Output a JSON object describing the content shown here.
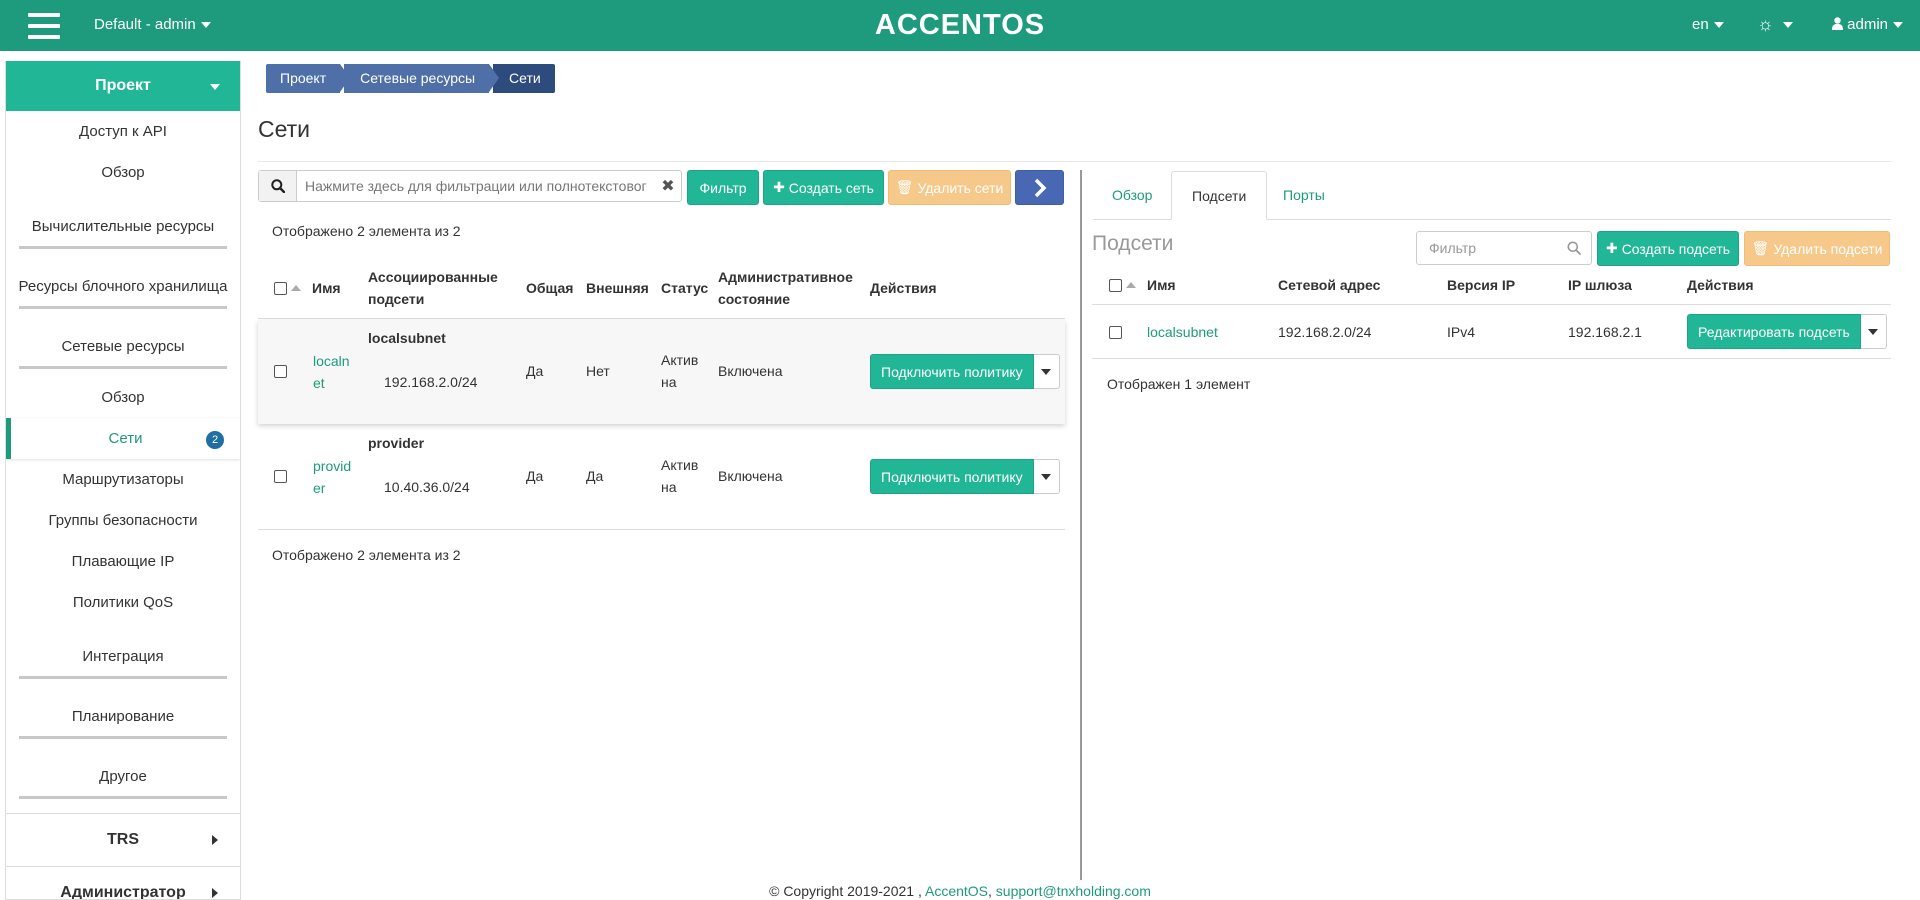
{
  "header": {
    "project_selector": "Default - admin",
    "logo": "ACCENTOS",
    "language": "en",
    "user": "admin"
  },
  "sidebar": {
    "project_label": "Проект",
    "items": [
      {
        "label": "Доступ к API",
        "type": "item"
      },
      {
        "label": "Обзор",
        "type": "item"
      },
      {
        "label": "Вычислительные ресурсы",
        "type": "section"
      },
      {
        "label": "Ресурсы блочного хранилища",
        "type": "section"
      },
      {
        "label": "Сетевые ресурсы",
        "type": "section"
      },
      {
        "label": "Обзор",
        "type": "item"
      },
      {
        "label": "Сети",
        "type": "active",
        "badge": "2"
      },
      {
        "label": "Маршрутизаторы",
        "type": "item"
      },
      {
        "label": "Группы безопасности",
        "type": "item"
      },
      {
        "label": "Плавающие IP",
        "type": "item"
      },
      {
        "label": "Политики QoS",
        "type": "item"
      },
      {
        "label": "Интеграция",
        "type": "section"
      },
      {
        "label": "Планирование",
        "type": "section"
      },
      {
        "label": "Другое",
        "type": "section"
      }
    ],
    "trs_label": "TRS",
    "admin_label": "Администратор"
  },
  "breadcrumb": [
    "Проект",
    "Сетевые ресурсы",
    "Сети"
  ],
  "page_title": "Сети",
  "networks": {
    "search_placeholder": "Нажмите здесь для фильтрации или полнотекстового ...",
    "filter_label": "Фильтр",
    "create_label": "Создать сеть",
    "delete_label": "Удалить сети",
    "count_top": "Отображено 2 элемента из 2",
    "count_bottom": "Отображено 2 элемента из 2",
    "columns": {
      "name": "Имя",
      "subnets_1": "Ассоциированные",
      "subnets_2": "подсети",
      "shared": "Общая",
      "external": "Внешняя",
      "status": "Статус",
      "admin_1": "Административное",
      "admin_2": "состояние",
      "actions": "Действия"
    },
    "rows": [
      {
        "name_1": "localn",
        "name_2": "et",
        "subnet_name": "localsubnet",
        "subnet_cidr": "192.168.2.0/24",
        "shared": "Да",
        "external": "Нет",
        "status_1": "Актив",
        "status_2": "на",
        "admin_state": "Включена",
        "action": "Подключить политику"
      },
      {
        "name_1": "provid",
        "name_2": "er",
        "subnet_name": "provider",
        "subnet_cidr": "10.40.36.0/24",
        "shared": "Да",
        "external": "Да",
        "status_1": "Актив",
        "status_2": "на",
        "admin_state": "Включена",
        "action": "Подключить политику"
      }
    ]
  },
  "detail": {
    "tabs": [
      "Обзор",
      "Подсети",
      "Порты"
    ],
    "section_title": "Подсети",
    "filter_placeholder": "Фильтр",
    "create_label": "Создать подсеть",
    "delete_label": "Удалить подсети",
    "columns": {
      "name": "Имя",
      "network_address": "Сетевой адрес",
      "ip_version": "Версия IP",
      "gateway": "IP шлюза",
      "actions": "Действия"
    },
    "rows": [
      {
        "name": "localsubnet",
        "network_address": "192.168.2.0/24",
        "ip_version": "IPv4",
        "gateway": "192.168.2.1",
        "action": "Редактировать подсеть"
      }
    ],
    "count": "Отображен 1 элемент"
  },
  "footer": {
    "copyright": "© Copyright 2019-2021 ,",
    "brand": "AccentOS",
    "separator": ",",
    "email": "support@tnxholding.com"
  }
}
